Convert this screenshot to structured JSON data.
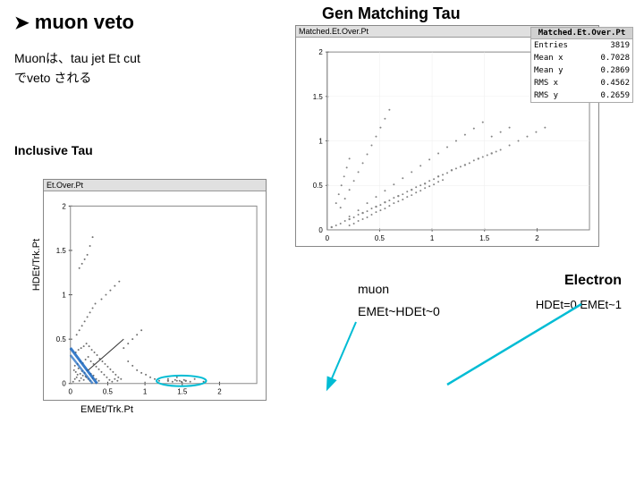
{
  "header": {
    "muon_veto": "muon veto",
    "arrow": "➤",
    "gen_matching_title": "Gen Matching Tau"
  },
  "description": {
    "line1": "Muonは、tau jet Et cut",
    "line2": "でveto される"
  },
  "left_plot": {
    "title": "Et.Over.Pt",
    "section_label": "Inclusive Tau",
    "y_axis": "HDEt/Trk.Pt",
    "x_axis": "EMEt/Trk.Pt",
    "y_max": "2",
    "y_15": "1.5",
    "y_1": "1",
    "y_05": "0.5",
    "x_values": [
      "0",
      "0.5",
      "1",
      "1.5",
      "2"
    ]
  },
  "right_plot": {
    "title": "Matched.Et.Over.Pt",
    "y_max": "2",
    "y_15": "1.5",
    "y_1": "1",
    "y_05": "0.5",
    "x_values": [
      "0",
      "0.5",
      "1",
      "1.5",
      "2"
    ]
  },
  "stats": {
    "box_title": "Matched.Et.Over.Pt",
    "entries_label": "Entries",
    "entries_value": "3819",
    "mean_x_label": "Mean x",
    "mean_x_value": "0.7028",
    "mean_y_label": "Mean y",
    "mean_y_value": "0.2869",
    "rms_x_label": "RMS x",
    "rms_x_value": "0.4562",
    "rms_y_label": "RMS y",
    "rms_y_value": "0.2659"
  },
  "annotations": {
    "muon": "muon",
    "emet_hdet": "EMEt~HDEt~0",
    "electron": "Electron",
    "hdet_zero": "HDEt=0 EMEt~1"
  },
  "colors": {
    "teal_circle": "#00bcd4",
    "blue_line": "#1565c0",
    "scatter_dot": "#333333"
  }
}
